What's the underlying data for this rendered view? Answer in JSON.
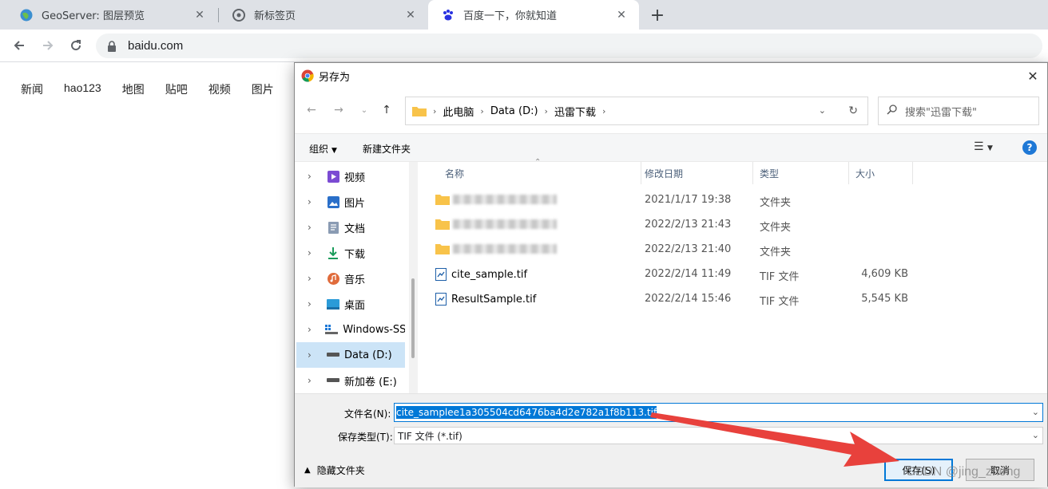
{
  "browser": {
    "tabs": [
      {
        "title": "GeoServer: 图层预览",
        "active": false
      },
      {
        "title": "新标签页",
        "active": false
      },
      {
        "title": "百度一下，你就知道",
        "active": true
      }
    ],
    "url": "baidu.com"
  },
  "page": {
    "nav": [
      "新闻",
      "hao123",
      "地图",
      "贴吧",
      "视频",
      "图片"
    ]
  },
  "dialog": {
    "title": "另存为",
    "breadcrumb": [
      "此电脑",
      "Data (D:)",
      "迅雷下载"
    ],
    "search_placeholder": "搜索\"迅雷下载\"",
    "toolbar": {
      "organize": "组织",
      "new_folder": "新建文件夹"
    },
    "nav_tree": [
      {
        "label": "视频",
        "icon": "video-icon"
      },
      {
        "label": "图片",
        "icon": "picture-icon"
      },
      {
        "label": "文档",
        "icon": "document-icon"
      },
      {
        "label": "下载",
        "icon": "download-icon"
      },
      {
        "label": "音乐",
        "icon": "music-icon"
      },
      {
        "label": "桌面",
        "icon": "desktop-icon"
      },
      {
        "label": "Windows-SSD",
        "icon": "drive-icon"
      },
      {
        "label": "Data (D:)",
        "icon": "drive-icon",
        "selected": true
      },
      {
        "label": "新加卷 (E:)",
        "icon": "drive-icon"
      }
    ],
    "columns": {
      "name": "名称",
      "date": "修改日期",
      "type": "类型",
      "size": "大小"
    },
    "files": [
      {
        "name": "",
        "date": "2021/1/17 19:38",
        "type": "文件夹",
        "size": "",
        "kind": "folder"
      },
      {
        "name": "",
        "date": "2022/2/13 21:43",
        "type": "文件夹",
        "size": "",
        "kind": "folder"
      },
      {
        "name": "",
        "date": "2022/2/13 21:40",
        "type": "文件夹",
        "size": "",
        "kind": "folder"
      },
      {
        "name": "cite_sample.tif",
        "date": "2022/2/14 11:49",
        "type": "TIF 文件",
        "size": "4,609 KB",
        "kind": "tif"
      },
      {
        "name": "ResultSample.tif",
        "date": "2022/2/14 15:46",
        "type": "TIF 文件",
        "size": "5,545 KB",
        "kind": "tif"
      }
    ],
    "filename_label": "文件名(N):",
    "filename_value": "cite_samplee1a305504cd6476ba4d2e782a1f8b113.tif",
    "filetype_label": "保存类型(T):",
    "filetype_value": "TIF 文件 (*.tif)",
    "hide_folders": "隐藏文件夹",
    "save_button": "保存(S)",
    "cancel_button": "取消"
  },
  "watermark": "CSDN @jing_zhong",
  "annotation_arrow_color": "#e8413c"
}
